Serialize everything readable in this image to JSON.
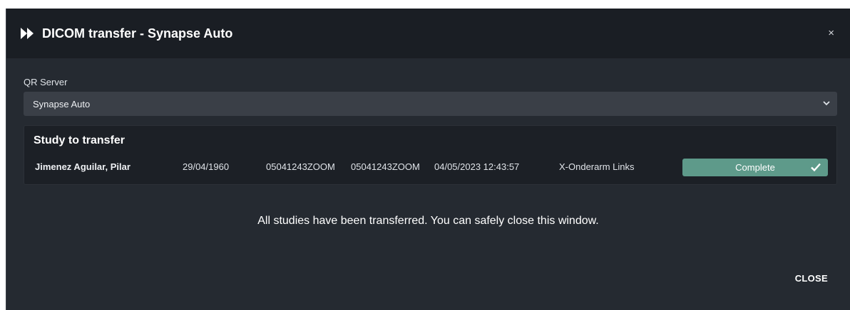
{
  "dialog": {
    "title": "DICOM transfer - Synapse Auto",
    "close_symbol": "×"
  },
  "qr_server": {
    "label": "QR Server",
    "selected": "Synapse Auto"
  },
  "study_panel": {
    "heading": "Study to transfer",
    "rows": [
      {
        "patient_name": "Jimenez Aguilar, Pilar",
        "birth_date": "29/04/1960",
        "patient_id": "05041243ZOOM",
        "accession": "05041243ZOOM",
        "study_date": "04/05/2023 12:43:57",
        "description": "X-Onderarm Links",
        "status": "Complete"
      }
    ]
  },
  "message": "All studies have been transferred. You can safely close this window.",
  "footer": {
    "close_label": "CLOSE"
  },
  "colors": {
    "background": "#252a31",
    "header": "#1a1e24",
    "status_complete": "#5e9a8a"
  },
  "icons": {
    "title": "fast-forward-icon",
    "select": "chevron-down-icon",
    "status": "check-icon"
  }
}
